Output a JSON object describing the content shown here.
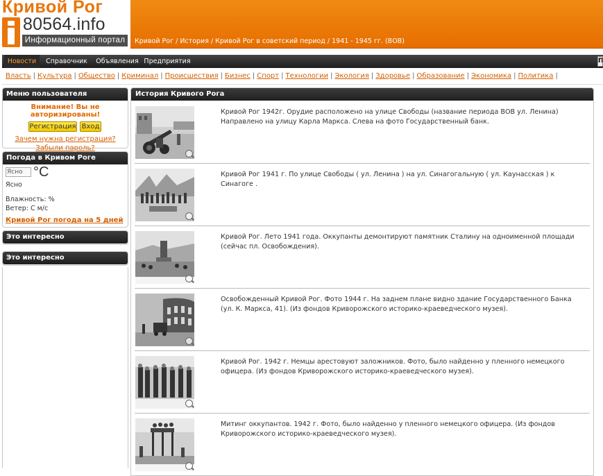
{
  "logo": {
    "title": "Кривой Рог",
    "domain": "80564.info",
    "subtitle": "Информационный портал",
    "colors": {
      "orange": "#e8760c",
      "dark": "#4d4d4d"
    }
  },
  "breadcrumb": "Кривой Рог / История / Кривой Рог в советский период / 1941 - 1945 гг. (ВОВ)",
  "nav": {
    "items": [
      {
        "label": "Новости",
        "active": true
      },
      {
        "label": "Справочник"
      },
      {
        "label": "Объявления"
      },
      {
        "label": "Предприятия"
      }
    ],
    "right_button": "П"
  },
  "categories": [
    "Власть",
    "Культура",
    "Общество",
    "Криминал",
    "Происшествия",
    "Бизнес",
    "Спорт",
    "Технологии",
    "Экология",
    "Здоровье",
    "Образование",
    "Экономика",
    "Политика"
  ],
  "sidebar": {
    "menu": {
      "title": "Меню пользователя",
      "warning": "Внимание! Вы не авторизированы!",
      "register_button": "Регистрация",
      "login_button": "Вход",
      "why_register_link": "Зачем нужна регистрация?",
      "forgot_password_link": "Забыли пароль?"
    },
    "weather": {
      "title": "Погода в Кривом Роге",
      "image_alt": "Ясно",
      "degree": "°C",
      "state": "Ясно",
      "humidity": "Влажность: %",
      "wind": "Ветер: С м/с",
      "forecast_link": "Кривой Рог погода на 5 дней"
    },
    "interesting": [
      "Это интересно",
      "Это интересно"
    ]
  },
  "main": {
    "title": "История Кривого Рога",
    "items": [
      {
        "text": "Кривой Рог 1942г. Орудие расположено на улице Свободы (название периода ВОВ ул. Ленина) Направлено на улицу Карла Маркса. Слева на фото Государственный банк."
      },
      {
        "text": "Кривой Рог 1941 г. По улице Свободы ( ул. Ленина ) на ул. Синагогальную ( ул. Каунасская ) к Синагоге ."
      },
      {
        "text": "Кривой Рог. Лето 1941 года. Оккупанты демонтируют памятник Сталину на одноименной площади (сейчас пл. Освобождения)."
      },
      {
        "text": "Освобожденный Кривой Рог. Фото 1944 г. На заднем плане видно здание Государственного Банка (ул. К. Маркса, 41). (Из фондов Криворожского историко-краеведческого музея)."
      },
      {
        "text": "Кривой Рог. 1942 г. Немцы арестовуют заложников. Фото, было найденно у пленного немецкого офицера. (Из фондов Криворожского историко-краеведческого музея)."
      },
      {
        "text": "Митинг оккупантов. 1942 г. Фото, было найденно у пленного немецкого офицера. (Из фондов Криворожского историко-краеведческого музея)."
      }
    ]
  }
}
